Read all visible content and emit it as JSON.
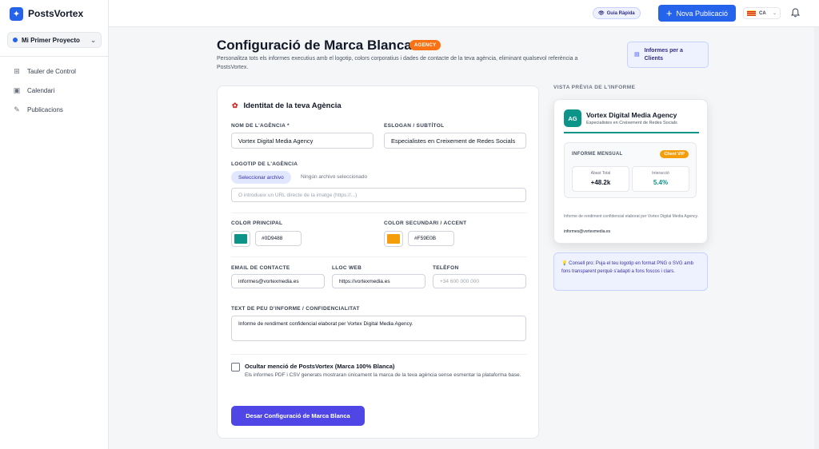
{
  "app": {
    "name": "PostsVortex",
    "logo_icon": "spark-icon",
    "accent": "#2563eb"
  },
  "sidebar": {
    "project": "Mi Primer Proyecto",
    "items": [
      {
        "label": "Tauler de Control",
        "icon": "grid-icon"
      },
      {
        "label": "Calendari",
        "icon": "calendar-icon"
      },
      {
        "label": "Publicacions",
        "icon": "edit-icon"
      }
    ]
  },
  "header": {
    "quick_guide": "Guia Ràpida",
    "new_post": "Nova Publicació",
    "language": "CA"
  },
  "page": {
    "title": "Configuració de Marca Blanca",
    "badge": "AGENCY",
    "description": "Personalitza tots els informes executius amb el logotip, colors corporatius i dades de contacte de la teva agència, eliminant qualsevol referència a PostsVortex.",
    "reports_button": "Informes per a Clients"
  },
  "form": {
    "section_title": "Identitat de la teva Agència",
    "agency_name_label": "NOM DE L'AGÈNCIA *",
    "agency_name_value": "Vortex Digital Media Agency",
    "slogan_label": "ESLOGAN / SUBTÍTOL",
    "slogan_value": "Especialistes en Creixement de Redes Socials",
    "logo_label": "LOGOTIP DE L'AGÈNCIA",
    "file_button": "Seleccionar archivo",
    "file_status": "Ningún archivo seleccionado",
    "logo_url_placeholder": "O introdueix un URL directe de la imatge (https://...)",
    "primary_color_label": "COLOR PRINCIPAL",
    "primary_color": "#0D9488",
    "secondary_color_label": "COLOR SECUNDARI / ACCENT",
    "secondary_color": "#F59E0B",
    "email_label": "EMAIL DE CONTACTE",
    "email_value": "informes@vortexmedia.es",
    "website_label": "LLOC WEB",
    "website_value": "https://vortexmedia.es",
    "phone_label": "TELÈFON",
    "phone_placeholder": "+34 600 000 000",
    "footer_label": "TEXT DE PEU D'INFORME / CONFIDENCIALITAT",
    "footer_value": "Informe de rendiment confidencial elaborat per Vortex Digital Media Agency.",
    "hide_title": "Ocultar menció de PostsVortex (Marca 100% Blanca)",
    "hide_desc": "Els informes PDF i CSV generats mostraran únicament la marca de la teva agència sense esmentar la plataforma base.",
    "save_button": "Desar Configuració de Marca Blanca"
  },
  "preview": {
    "label": "VISTA PRÈVIA DE L'INFORME",
    "initials": "AG",
    "name": "Vortex Digital Media Agency",
    "slogan": "Especialistes en Creixement de Redes Socials",
    "report_title": "INFORME MENSUAL",
    "vip_badge": "Client VIP",
    "metric1_label": "Abast Total",
    "metric1_value": "+48.2k",
    "metric2_label": "Interacció",
    "metric2_value": "5.4%",
    "footer_text": "Informe de rendiment confidencial elaborat per Vortex Digital Media Agency.",
    "email": "informes@vortexmedia.es"
  },
  "tip": {
    "text": "Consell pro: Puja el teu logotip en format PNG o SVG amb fons transparent perquè s'adapti a fons foscos i clars."
  }
}
